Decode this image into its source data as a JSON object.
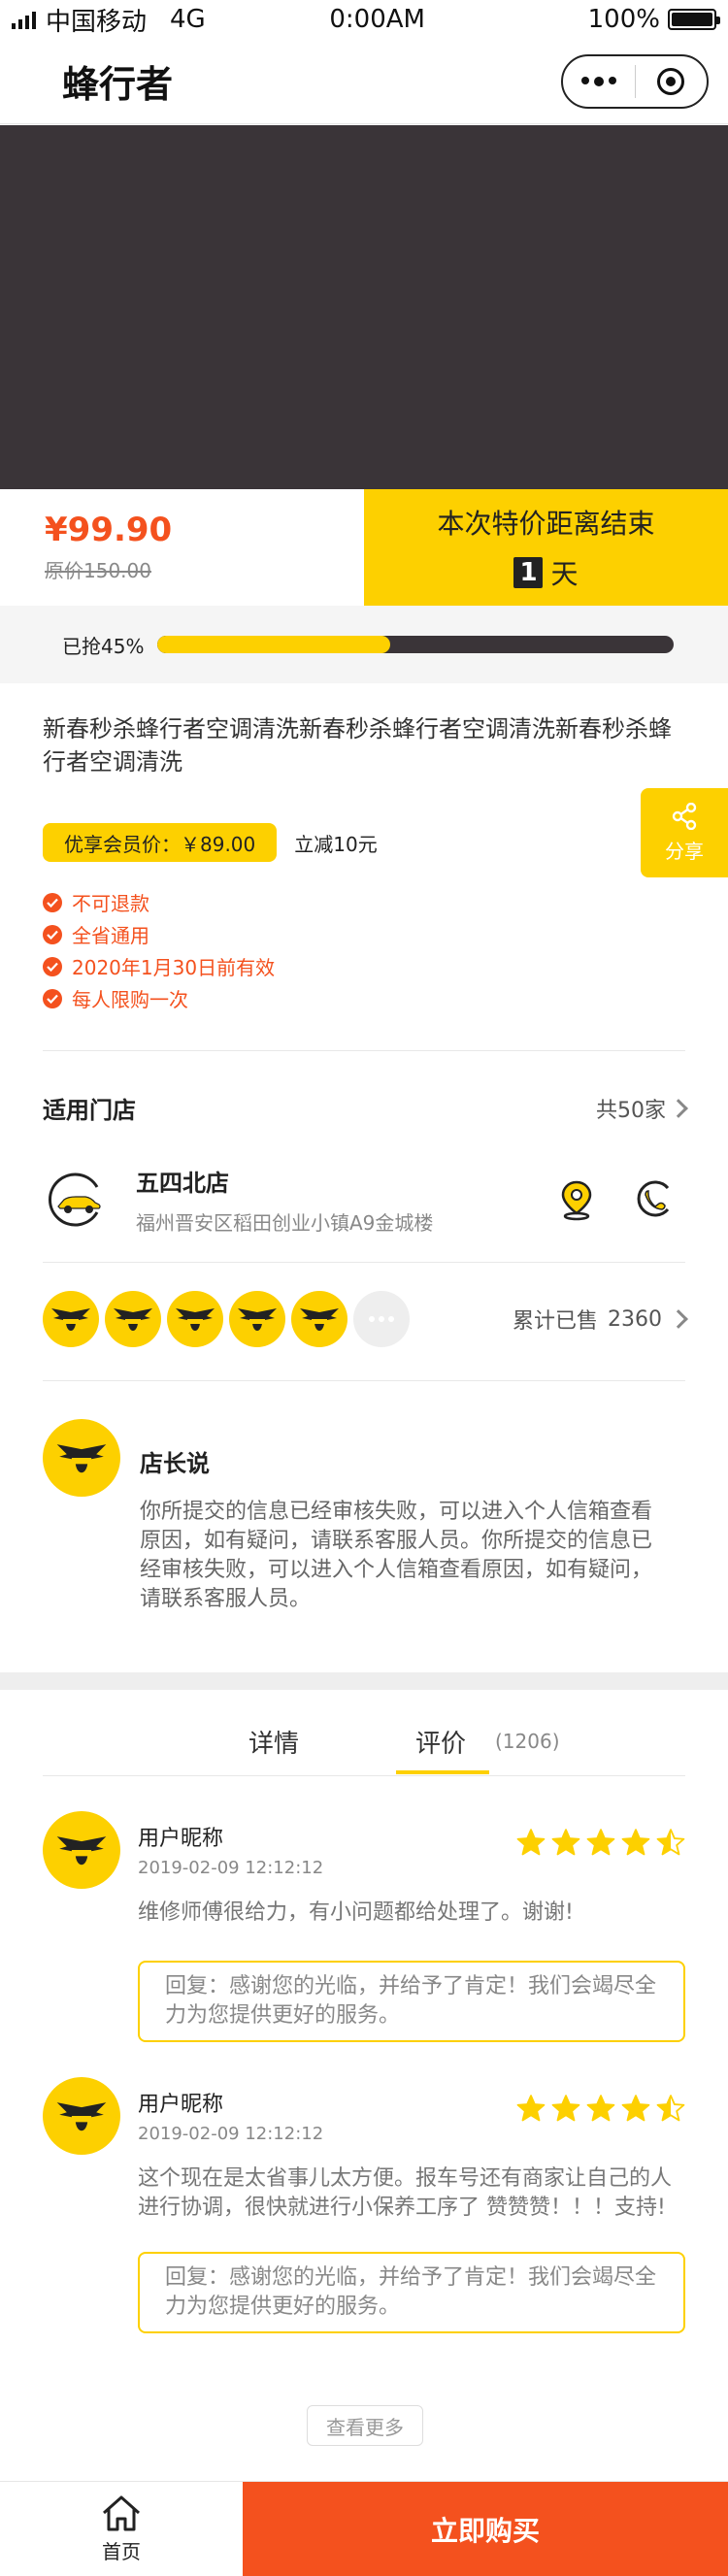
{
  "status_bar": {
    "carrier": "中国移动",
    "network": "4G",
    "time": "0:00AM",
    "battery": "100%"
  },
  "nav": {
    "title": "蜂行者"
  },
  "price": {
    "currency": "¥",
    "current": "99.90",
    "original_label": "原价",
    "original_value": "150.00"
  },
  "countdown": {
    "title": "本次特价距离结束",
    "days": "1",
    "unit": "天"
  },
  "progress": {
    "label": "已抢45%",
    "percent": 45
  },
  "product": {
    "title": "新春秒杀蜂行者空调清洗新春秒杀蜂行者空调清洗新春秒杀蜂行者空调清洗",
    "member_price": "优享会员价：￥89.00",
    "discount": "立减10元",
    "features": [
      "不可退款",
      "全省通用",
      "2020年1月30日前有效",
      "每人限购一次"
    ]
  },
  "share": {
    "label": "分享"
  },
  "stores": {
    "title": "适用门店",
    "count": "共50家",
    "store": {
      "name": "五四北店",
      "address": "福州晋安区稻田创业小镇A9金城楼"
    }
  },
  "buyers": {
    "sold_label": "累计已售",
    "sold_count": "2360"
  },
  "owner": {
    "title": "店长说",
    "text": "你所提交的信息已经审核失败，可以进入个人信箱查看原因，如有疑问，请联系客服人员。你所提交的信息已经审核失败，可以进入个人信箱查看原因，如有疑问，请联系客服人员。"
  },
  "tabs": [
    {
      "label": "详情",
      "active": false
    },
    {
      "label": "评价",
      "active": true,
      "count": "(1206)"
    }
  ],
  "reviews": [
    {
      "name": "用户昵称",
      "date": "2019-02-09 12:12:12",
      "rating": 4.5,
      "text": "维修师傅很给力，有小问题都给处理了。谢谢!",
      "reply": "回复：感谢您的光临，并给予了肯定！我们会竭尽全力为您提供更好的服务。"
    },
    {
      "name": "用户昵称",
      "date": "2019-02-09 12:12:12",
      "rating": 4.5,
      "text": "这个现在是太省事儿太方便。报车号还有商家让自己的人进行协调，很快就进行小保养工序了 赞赞赞！！！支持!",
      "reply": "回复：感谢您的光临，并给予了肯定！我们会竭尽全力为您提供更好的服务。"
    }
  ],
  "see_more": "查看更多",
  "bottom_bar": {
    "home_label": "首页",
    "buy_label": "立即购买"
  },
  "colors": {
    "accent_yellow": "#fdd000",
    "accent_orange": "#f4511e",
    "banner": "#3a3438"
  },
  "icons": [
    "signal-icon",
    "battery-icon",
    "more-dots-icon",
    "target-icon",
    "share-icon",
    "check-icon",
    "chevron-right-icon",
    "car-logo-icon",
    "location-pin-icon",
    "phone-icon",
    "bee-logo-icon",
    "star-icon",
    "half-star-icon",
    "home-icon"
  ]
}
